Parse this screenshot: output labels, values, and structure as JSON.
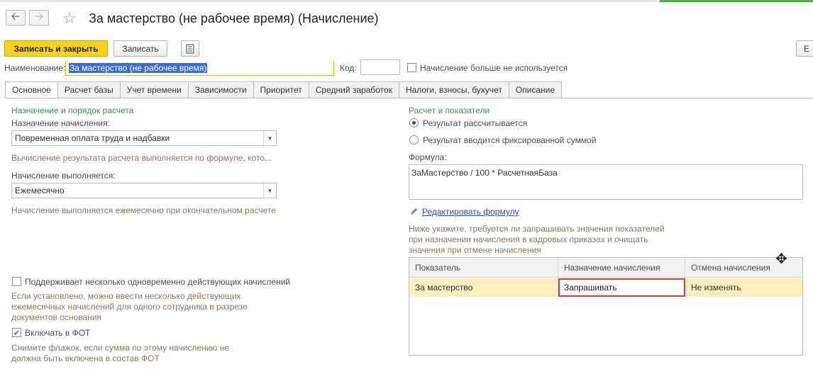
{
  "window": {
    "title": "За мастерство (не рабочее время) (Начисление)"
  },
  "nav": {
    "back_icon": "arrow-left-icon",
    "forward_icon": "arrow-right-icon",
    "favorite_icon": "star-icon"
  },
  "toolbar": {
    "save_close_label": "Записать и закрыть",
    "save_label": "Записать",
    "right_button_label": "Е"
  },
  "header": {
    "name_label": "Наименование:",
    "name_value": "За мастерство (не рабочее время)",
    "code_label": "Код:",
    "code_value": "",
    "not_used_label": "Начисление больше не используется",
    "not_used_checked": false
  },
  "tabs": [
    {
      "label": "Основное",
      "active": true
    },
    {
      "label": "Расчет базы",
      "active": false
    },
    {
      "label": "Учет времени",
      "active": false
    },
    {
      "label": "Зависимости",
      "active": false
    },
    {
      "label": "Приоритет",
      "active": false
    },
    {
      "label": "Средний заработок",
      "active": false
    },
    {
      "label": "Налоги, взносы, бухучет",
      "active": false
    },
    {
      "label": "Описание",
      "active": false
    }
  ],
  "left": {
    "section_title": "Назначение и порядок расчета",
    "purpose_label": "Назначение начисления:",
    "purpose_value": "Повременная оплата труда и надбавки",
    "formula_hint": "Вычисление результата расчета выполняется по формуле, кото...",
    "execution_label": "Начисление выполняется:",
    "execution_value": "Ежемесячно",
    "execution_hint": "Начисление выполняется ежемесячно при окончательном расчете",
    "multi_label": "Поддерживает несколько одновременно действующих начислений",
    "multi_checked": false,
    "multi_hint_1": "Если установлено, можно ввести несколько действующих",
    "multi_hint_2": "ежемесячных начислений для одного сотрудника в разрезе",
    "multi_hint_3": "документов основания",
    "fot_label": "Включать в ФОТ",
    "fot_checked": true,
    "fot_hint_1": "Снимите флажок, если сумма по этому начислению не",
    "fot_hint_2": "должна быть включена в состав ФОТ"
  },
  "right": {
    "section_title": "Расчет и показатели",
    "radio_calculated": "Результат рассчитывается",
    "radio_fixed": "Результат вводится фиксированной суммой",
    "selected_radio": "calculated",
    "formula_label": "Формула:",
    "formula_value": "ЗаМастерство / 100 * РасчетнаяБаза",
    "edit_formula_link": "Редактировать формулу",
    "edit_icon": "pencil-icon",
    "indicators_hint_1": "Ниже укажите, требуется ли запрашивать значения показателей",
    "indicators_hint_2": "при назначении начисления в кадровых приказах и очищать",
    "indicators_hint_3": "значения при отмене начисления",
    "table": {
      "columns": [
        "Показатель",
        "Назначение начисления",
        "Отмена начисления"
      ],
      "rows": [
        [
          "За мастерство",
          "Запрашивать",
          "Не изменять"
        ]
      ]
    }
  },
  "colors": {
    "accent_yellow": "#f7d31a",
    "section_green": "#2f9a52",
    "hint_text": "#8a7a5a",
    "link_blue": "#1f4fbf",
    "row_highlight": "#fbf0be",
    "active_cell_border": "#e0393e"
  }
}
